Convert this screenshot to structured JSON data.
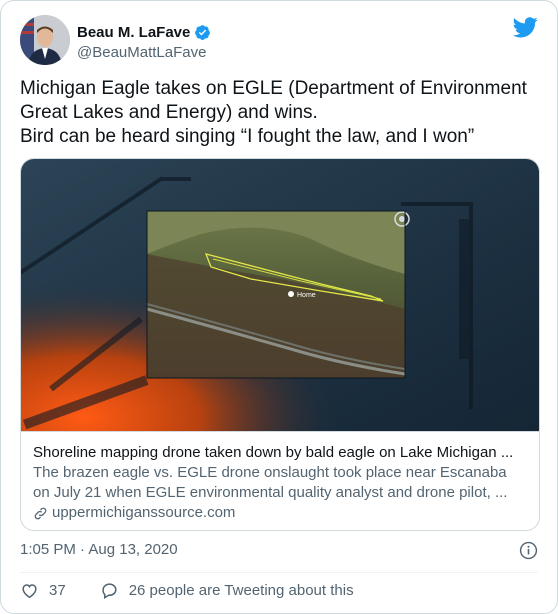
{
  "author": {
    "name": "Beau M. LaFave",
    "handle": "@BeauMattLaFave",
    "verified": true,
    "verified_color": "#1d9bf0"
  },
  "platform_icon": "twitter-bird-icon",
  "brand_color": "#1d9bf0",
  "tweet": {
    "lines": [
      "Michigan Eagle takes on EGLE (Department of Environment",
      "Great Lakes and Energy) and wins.",
      "Bird can be heard singing “I fought the law, and I won”"
    ]
  },
  "card": {
    "map_pin_label": "Home",
    "title": "Shoreline mapping drone taken down by bald eagle on Lake Michigan ...",
    "description_lines": [
      "The brazen eagle vs. EGLE drone onslaught took place near Escanaba",
      "on July 21 when EGLE environmental quality analyst and drone pilot, ..."
    ],
    "domain": "uppermichiganssource.com"
  },
  "timestamp": "1:05 PM · Aug 13, 2020",
  "actions": {
    "likes": "37",
    "conversation": "26 people are Tweeting about this"
  }
}
